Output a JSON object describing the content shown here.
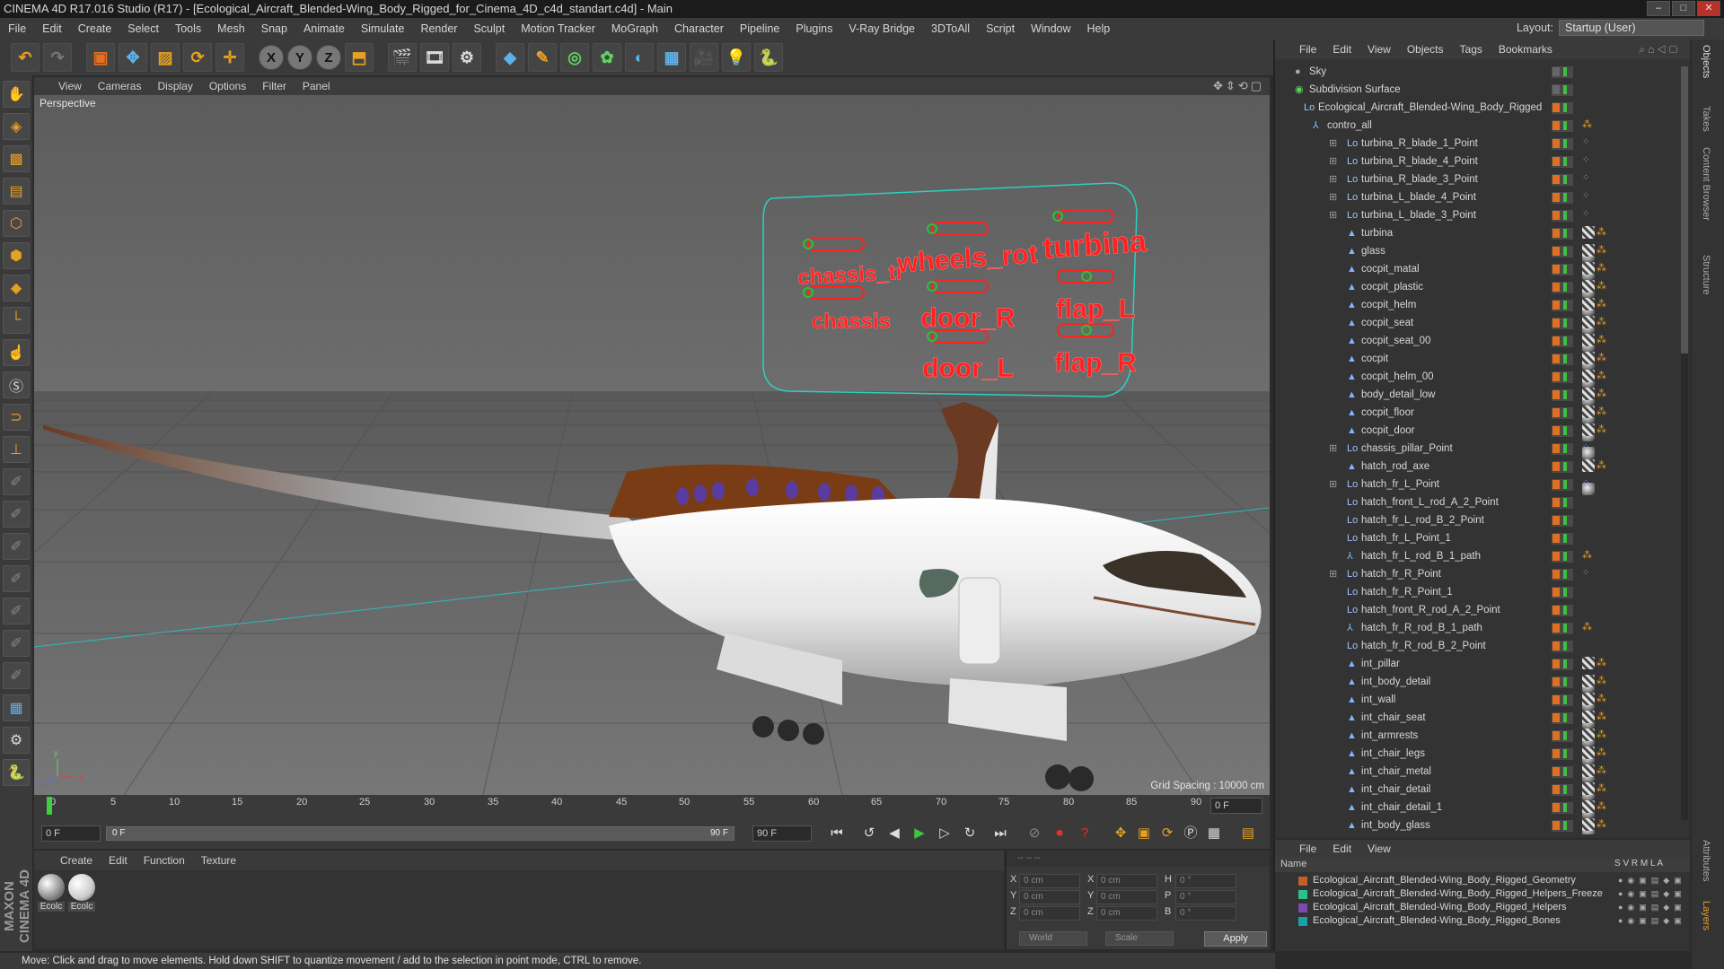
{
  "window_title": "CINEMA 4D R17.016 Studio (R17) - [Ecological_Aircraft_Blended-Wing_Body_Rigged_for_Cinema_4D_c4d_standart.c4d] - Main",
  "menubar": {
    "items": [
      "File",
      "Edit",
      "Create",
      "Select",
      "Tools",
      "Mesh",
      "Snap",
      "Animate",
      "Simulate",
      "Render",
      "Sculpt",
      "Motion Tracker",
      "MoGraph",
      "Character",
      "Pipeline",
      "Plugins",
      "V-Ray Bridge",
      "3DToAll",
      "Script",
      "Window",
      "Help"
    ],
    "layout_label": "Layout:",
    "layout_value": "Startup (User)"
  },
  "viewport": {
    "menu": [
      "View",
      "Cameras",
      "Display",
      "Options",
      "Filter",
      "Panel"
    ],
    "camera_label": "Perspective",
    "grid_spacing": "Grid Spacing : 10000 cm",
    "controller_labels": [
      "chassis_tr",
      "wheels_rot",
      "turbina",
      "chassis",
      "door_R",
      "flap_L",
      "door_L",
      "flap_R"
    ]
  },
  "timeline": {
    "ticks": [
      "0",
      "5",
      "10",
      "15",
      "20",
      "25",
      "30",
      "35",
      "40",
      "45",
      "50",
      "55",
      "60",
      "65",
      "70",
      "75",
      "80",
      "85",
      "90"
    ],
    "current_frame": "0 F"
  },
  "transport": {
    "start_frame": "0 F",
    "slider_start": "0 F",
    "slider_end": "90 F",
    "end_frame": "90 F"
  },
  "materials": {
    "menu": [
      "Create",
      "Edit",
      "Function",
      "Texture"
    ],
    "items": [
      "Ecolc",
      "Ecolc"
    ]
  },
  "coordinates": {
    "header": "--                    --                    --",
    "x_label": "X",
    "y_label": "Y",
    "z_label": "Z",
    "h_label": "H",
    "p_label": "P",
    "b_label": "B",
    "pos_x": "0 cm",
    "pos_y": "0 cm",
    "pos_z": "0 cm",
    "size_x": "0 cm",
    "size_y": "0 cm",
    "size_z": "0 cm",
    "rot_h": "0 °",
    "rot_p": "0 °",
    "rot_b": "0 °",
    "mode1": "World",
    "mode2": "Scale",
    "apply": "Apply"
  },
  "status_text": "Move: Click and drag to move elements. Hold down SHIFT to quantize movement / add to the selection in point mode, CTRL to remove.",
  "object_manager": {
    "menu": [
      "File",
      "Edit",
      "View",
      "Objects",
      "Tags",
      "Bookmarks"
    ],
    "rows": [
      {
        "name": "Sky",
        "indent": 0,
        "icon": "sky",
        "tags": ""
      },
      {
        "name": "Subdivision Surface",
        "indent": 0,
        "icon": "subdiv",
        "tags": ""
      },
      {
        "name": "Ecological_Aircraft_Blended-Wing_Body_Rigged",
        "indent": 1,
        "icon": "null",
        "tags": ""
      },
      {
        "name": "contro_all",
        "indent": 2,
        "icon": "bone",
        "tags": "o"
      },
      {
        "name": "turbina_R_blade_1_Point",
        "indent": 3,
        "icon": "null",
        "tags": "x"
      },
      {
        "name": "turbina_R_blade_4_Point",
        "indent": 3,
        "icon": "null",
        "tags": "x"
      },
      {
        "name": "turbina_R_blade_3_Point",
        "indent": 3,
        "icon": "null",
        "tags": "x"
      },
      {
        "name": "turbina_L_blade_4_Point",
        "indent": 3,
        "icon": "null",
        "tags": "x"
      },
      {
        "name": "turbina_L_blade_3_Point",
        "indent": 3,
        "icon": "null",
        "tags": "x"
      },
      {
        "name": "turbina",
        "indent": 3,
        "icon": "poly",
        "tags": "m"
      },
      {
        "name": "glass",
        "indent": 3,
        "icon": "poly",
        "tags": "m"
      },
      {
        "name": "cocpit_matal",
        "indent": 3,
        "icon": "poly",
        "tags": "m"
      },
      {
        "name": "cocpit_plastic",
        "indent": 3,
        "icon": "poly",
        "tags": "m"
      },
      {
        "name": "cocpit_helm",
        "indent": 3,
        "icon": "poly",
        "tags": "m"
      },
      {
        "name": "cocpit_seat",
        "indent": 3,
        "icon": "poly",
        "tags": "m"
      },
      {
        "name": "cocpit_seat_00",
        "indent": 3,
        "icon": "poly",
        "tags": "m"
      },
      {
        "name": "cocpit",
        "indent": 3,
        "icon": "poly",
        "tags": "m"
      },
      {
        "name": "cocpit_helm_00",
        "indent": 3,
        "icon": "poly",
        "tags": "m"
      },
      {
        "name": "body_detail_low",
        "indent": 3,
        "icon": "poly",
        "tags": "m"
      },
      {
        "name": "cocpit_floor",
        "indent": 3,
        "icon": "poly",
        "tags": "m"
      },
      {
        "name": "cocpit_door",
        "indent": 3,
        "icon": "poly",
        "tags": "m"
      },
      {
        "name": "chassis_pillar_Point",
        "indent": 3,
        "icon": "null",
        "tags": "x"
      },
      {
        "name": "hatch_rod_axe",
        "indent": 3,
        "icon": "poly",
        "tags": "m"
      },
      {
        "name": "hatch_fr_L_Point",
        "indent": 3,
        "icon": "null",
        "tags": "x"
      },
      {
        "name": "hatch_front_L_rod_A_2_Point",
        "indent": 3,
        "icon": "null",
        "tags": ""
      },
      {
        "name": "hatch_fr_L_rod_B_2_Point",
        "indent": 3,
        "icon": "null",
        "tags": ""
      },
      {
        "name": "hatch_fr_L_Point_1",
        "indent": 3,
        "icon": "null",
        "tags": ""
      },
      {
        "name": "hatch_fr_L_rod_B_1_path",
        "indent": 3,
        "icon": "bone",
        "tags": "o"
      },
      {
        "name": "hatch_fr_R_Point",
        "indent": 3,
        "icon": "null",
        "tags": "x"
      },
      {
        "name": "hatch_fr_R_Point_1",
        "indent": 3,
        "icon": "null",
        "tags": ""
      },
      {
        "name": "hatch_front_R_rod_A_2_Point",
        "indent": 3,
        "icon": "null",
        "tags": ""
      },
      {
        "name": "hatch_fr_R_rod_B_1_path",
        "indent": 3,
        "icon": "bone",
        "tags": "o"
      },
      {
        "name": "hatch_fr_R_rod_B_2_Point",
        "indent": 3,
        "icon": "null",
        "tags": ""
      },
      {
        "name": "int_pillar",
        "indent": 3,
        "icon": "poly",
        "tags": "m"
      },
      {
        "name": "int_body_detail",
        "indent": 3,
        "icon": "poly",
        "tags": "m"
      },
      {
        "name": "int_wall",
        "indent": 3,
        "icon": "poly",
        "tags": "m"
      },
      {
        "name": "int_chair_seat",
        "indent": 3,
        "icon": "poly",
        "tags": "m"
      },
      {
        "name": "int_armrests",
        "indent": 3,
        "icon": "poly",
        "tags": "m"
      },
      {
        "name": "int_chair_legs",
        "indent": 3,
        "icon": "poly",
        "tags": "m"
      },
      {
        "name": "int_chair_metal",
        "indent": 3,
        "icon": "poly",
        "tags": "m"
      },
      {
        "name": "int_chair_detail",
        "indent": 3,
        "icon": "poly",
        "tags": "m"
      },
      {
        "name": "int_chair_detail_1",
        "indent": 3,
        "icon": "poly",
        "tags": "m"
      },
      {
        "name": "int_body_glass",
        "indent": 3,
        "icon": "poly",
        "tags": "m"
      }
    ]
  },
  "layer_manager": {
    "menu": [
      "File",
      "Edit",
      "View"
    ],
    "header_name": "Name",
    "header_cols": "S  V  R  M  L  A",
    "layers": [
      {
        "name": "Ecological_Aircraft_Blended-Wing_Body_Rigged_Geometry",
        "color": "#c0602a"
      },
      {
        "name": "Ecological_Aircraft_Blended-Wing_Body_Rigged_Helpers_Freeze",
        "color": "#2ec08a"
      },
      {
        "name": "Ecological_Aircraft_Blended-Wing_Body_Rigged_Helpers",
        "color": "#7a4ab0"
      },
      {
        "name": "Ecological_Aircraft_Blended-Wing_Body_Rigged_Bones",
        "color": "#1aa0a8"
      }
    ]
  },
  "side_tabs": [
    "Objects",
    "Takes",
    "Content Browser",
    "Structure",
    "Attributes",
    "Layers"
  ]
}
